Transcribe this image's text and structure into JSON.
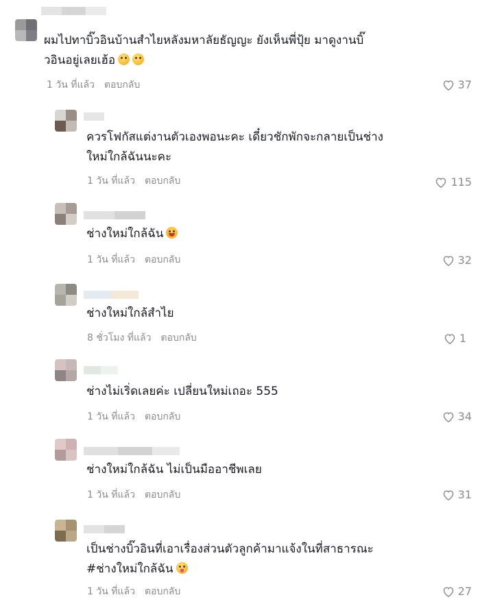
{
  "comments": [
    {
      "text_lines": [
        "ผมไปทาบิ๊วอินบ้านสำไยหลังมหาลัยธัญญะ ยังเห็นพี่ปุ้ย มาดูงานบิ๊",
        "วอินอยู่เลยเฮ้อ"
      ],
      "emoji": "hot-face",
      "time": "1 วัน ที่แล้ว",
      "reply": "ตอบกลับ",
      "likes": "37"
    },
    {
      "text_lines": [
        "ควรโฟกัสแต่งานตัวเองพอนะคะ เดี๋ยวชักพักจะกลายเป็นช่าง",
        "ใหม่ใกล้ฉันนะคะ"
      ],
      "emoji": "",
      "time": "1 วัน ที่แล้ว",
      "reply": "ตอบกลับ",
      "likes": "115"
    },
    {
      "text_lines": [
        "ช่างใหม่ใกล้ฉัน"
      ],
      "emoji": "laughing",
      "time": "1 วัน ที่แล้ว",
      "reply": "ตอบกลับ",
      "likes": "32"
    },
    {
      "text_lines": [
        "ช่างใหม่ใกล้สำไย"
      ],
      "emoji": "",
      "time": "8 ชั่วโมง ที่แล้ว",
      "reply": "ตอบกลับ",
      "likes": "1"
    },
    {
      "text_lines": [
        "ช่างไม่เริ่ดเลยค่ะ เปลี่ยนใหม่เถอะ 555"
      ],
      "emoji": "",
      "time": "1 วัน ที่แล้ว",
      "reply": "ตอบกลับ",
      "likes": "34"
    },
    {
      "text_lines": [
        "ช่างใหม่ใกล้ฉัน ไม่เป็นมืออาชีพเลย"
      ],
      "emoji": "",
      "time": "1 วัน ที่แล้ว",
      "reply": "ตอบกลับ",
      "likes": "31"
    },
    {
      "text_lines": [
        "เป็นช่างบิ๊วอินที่เอาเรื่องส่วนตัวลูกค้ามาแจ้งในที่สาธารณะ",
        "#ช่างใหม่ใกล้ฉัน"
      ],
      "emoji": "tongue-face",
      "time": "1 วัน ที่แล้ว",
      "reply": "ตอบกลับ",
      "likes": "27"
    }
  ],
  "colors": {
    "text": "#161823",
    "muted": "#8a8b91",
    "background": "#ffffff"
  }
}
